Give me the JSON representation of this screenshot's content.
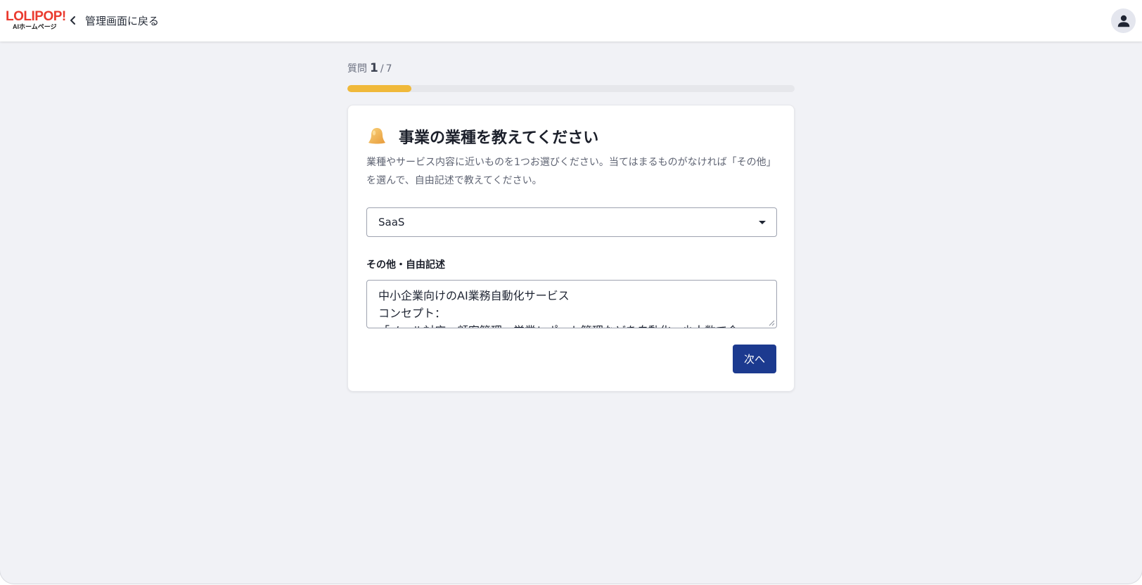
{
  "header": {
    "logo_text": "LOLIPOP!",
    "logo_subtext": "AIホームページ",
    "back_label": "管理画面に戻る",
    "avatar_icon": "person-icon"
  },
  "progress": {
    "label": "質問",
    "current": "1",
    "separator": "/",
    "total": "7",
    "fraction": 0.143,
    "color": "#f0b93a"
  },
  "question": {
    "icon": "bell-icon",
    "title": "事業の業種を教えてください",
    "description": "業種やサービス内容に近いものを1つお選びください。当てはまるものがなければ「その他」を選んで、自由記述で教えてください。"
  },
  "industry_select": {
    "value": "SaaS"
  },
  "free_text": {
    "label": "その他・自由記述",
    "lines": [
      "中小企業向けのAI業務自動化サービス",
      "コンセプト：",
      "「メール対応・顧客管理・営業レポート管理などを自動化、少人数で会"
    ]
  },
  "actions": {
    "next_label": "次へ",
    "primary_color": "#1c3a8f"
  }
}
